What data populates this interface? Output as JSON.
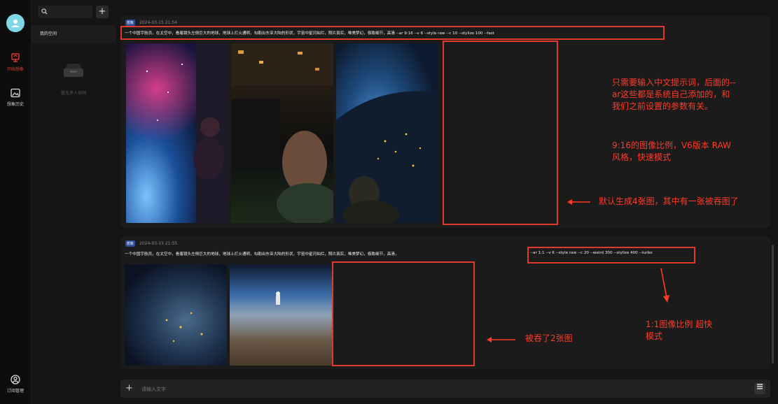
{
  "rail": {
    "items": [
      {
        "label": "开始想象",
        "icon": "sparkle-icon"
      },
      {
        "label": "想象历史",
        "icon": "image-icon"
      }
    ],
    "bottom": {
      "label": "订阅管理",
      "icon": "account-icon"
    }
  },
  "sidebar": {
    "space_label": "我的空间",
    "empty_label": "暂无多人协同"
  },
  "messages": [
    {
      "tag": "想象",
      "time": "2024-03-15 21:54",
      "prompt": "一个中国宇航员，在太空中，看着镜头左侧巨大的地球，地球上灯火通明，勾勒出东亚大陆的形状，宇宙中星河灿烂，照片真实，唯美梦幻，极致细节，高清 --ar 9:16 --v 6 --style raw --c 10 --stylize 100 --fast",
      "annotations": [
        "只需要输入中文提示词，后面的--ar这些都是系统自己添加的，和我们之前设置的参数有关。",
        "9:16的图像比例，V6版本 RAW风格，快速模式",
        "默认生成4张图，其中有一张被吞图了"
      ]
    },
    {
      "tag": "想象",
      "time": "2024-03-15 21:55",
      "prompt": "一个中国宇航员，在太空中，看着镜头左侧巨大的地球，地球上灯火通明，勾勒出东亚大陆的形状，宇宙中星河灿烂，照片真实，唯美梦幻，极致细节，高清，",
      "params": "--ar 1:1 --v 6 --style raw --c 20 --weird 300 --stylize 400 --turbo",
      "annotations": [
        "被吞了2张图",
        "1:1图像比例 超快模式"
      ]
    }
  ],
  "input": {
    "placeholder": "请输入文字"
  }
}
